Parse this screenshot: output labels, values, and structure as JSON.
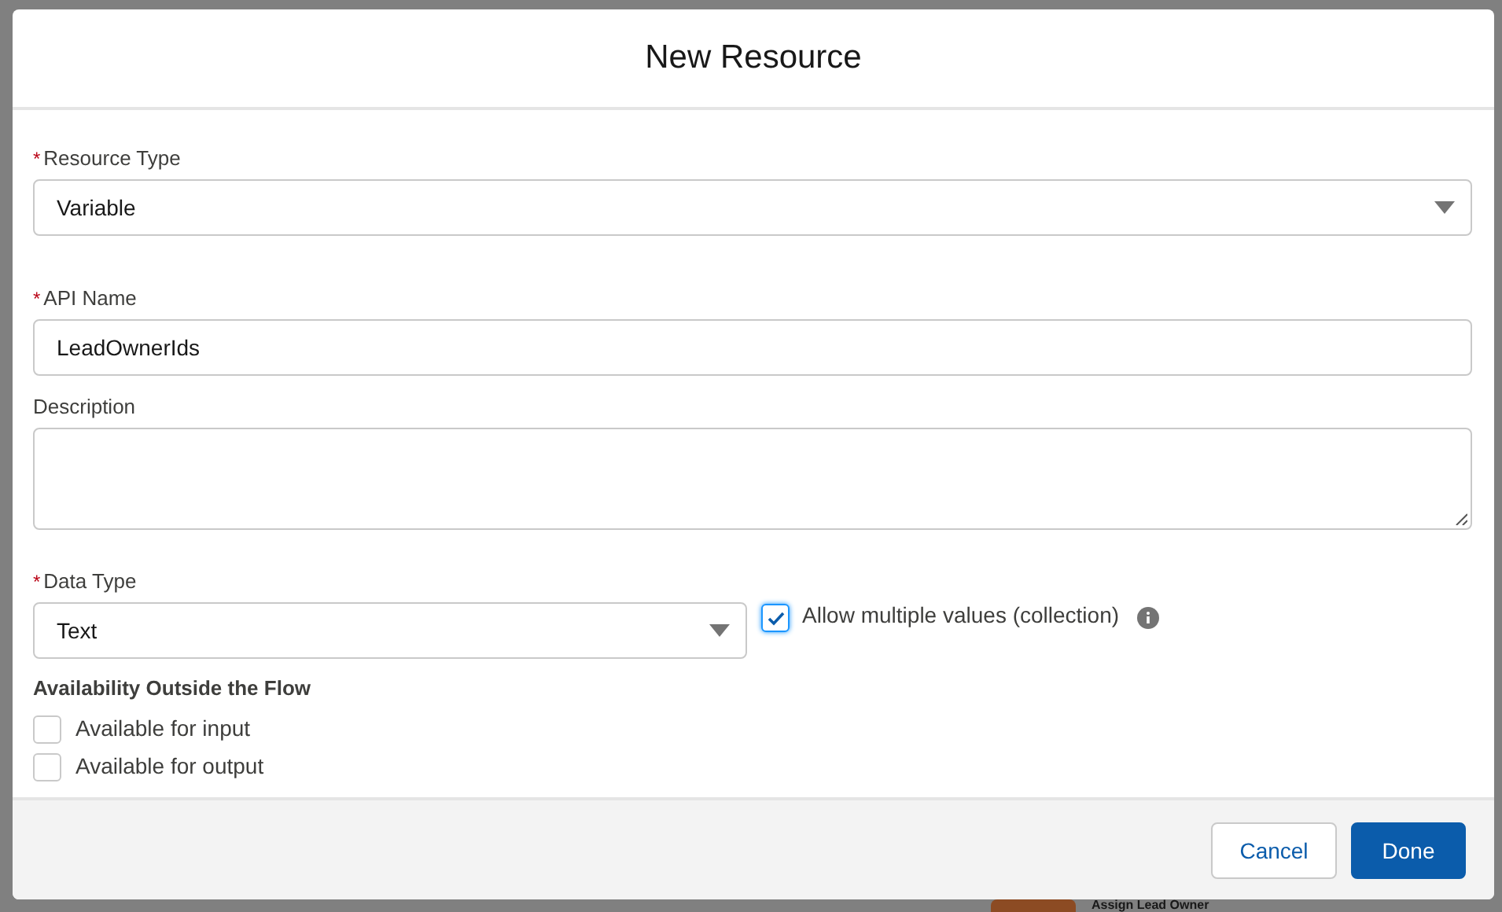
{
  "dialog": {
    "title": "New Resource"
  },
  "fields": [
    {
      "kind": "select",
      "required_marker": "*",
      "label": "Resource Type",
      "value": "Variable"
    },
    {
      "kind": "input",
      "required_marker": "*",
      "label": "API Name",
      "value": "LeadOwnerIds"
    },
    {
      "kind": "textarea",
      "label": "Description"
    }
  ],
  "data_type": {
    "required_marker": "*",
    "label": "Data Type",
    "value": "Text",
    "collection": {
      "label": "Allow multiple values (collection)",
      "checked": true
    }
  },
  "availability": {
    "heading": "Availability Outside the Flow",
    "options": [
      {
        "label": "Available for input",
        "checked": false
      },
      {
        "label": "Available for output",
        "checked": false
      }
    ]
  },
  "buttons": [
    {
      "label": "Cancel",
      "kind": "neutral"
    },
    {
      "label": "Done",
      "kind": "brand"
    }
  ],
  "background_node": {
    "label": "Assign Lead Owner"
  }
}
